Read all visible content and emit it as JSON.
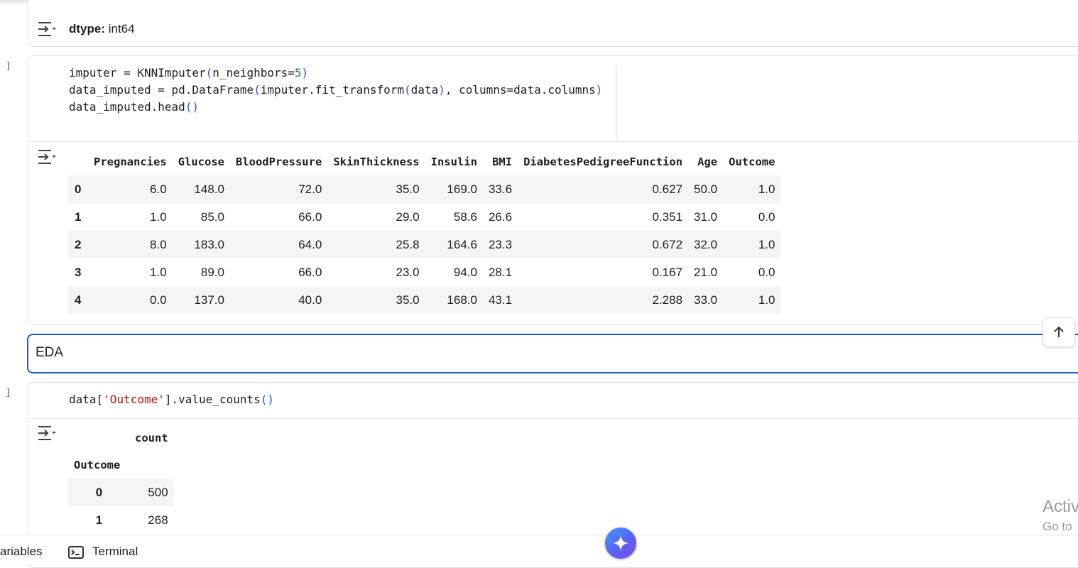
{
  "cells": [
    {
      "type": "output_only",
      "output": {
        "label_bold": "dtype:",
        "label_value": " int64"
      }
    },
    {
      "type": "code",
      "bracket": "]",
      "code_lines": [
        "imputer = KNNImputer(n_neighbors=5)",
        "data_imputed = pd.DataFrame(imputer.fit_transform(data), columns=data.columns)",
        "data_imputed.head()"
      ],
      "table": {
        "columns": [
          "",
          "Pregnancies",
          "Glucose",
          "BloodPressure",
          "SkinThickness",
          "Insulin",
          "BMI",
          "DiabetesPedigreeFunction",
          "Age",
          "Outcome"
        ],
        "rows": [
          [
            "0",
            "6.0",
            "148.0",
            "72.0",
            "35.0",
            "169.0",
            "33.6",
            "0.627",
            "50.0",
            "1.0"
          ],
          [
            "1",
            "1.0",
            "85.0",
            "66.0",
            "29.0",
            "58.6",
            "26.6",
            "0.351",
            "31.0",
            "0.0"
          ],
          [
            "2",
            "8.0",
            "183.0",
            "64.0",
            "25.8",
            "164.6",
            "23.3",
            "0.672",
            "32.0",
            "1.0"
          ],
          [
            "3",
            "1.0",
            "89.0",
            "66.0",
            "23.0",
            "94.0",
            "28.1",
            "0.167",
            "21.0",
            "0.0"
          ],
          [
            "4",
            "0.0",
            "137.0",
            "40.0",
            "35.0",
            "168.0",
            "43.1",
            "2.288",
            "33.0",
            "1.0"
          ]
        ]
      }
    },
    {
      "type": "markdown",
      "text": "EDA"
    },
    {
      "type": "code",
      "bracket": "]",
      "code_line": "data['Outcome'].value_counts()",
      "table": {
        "column_header": "count",
        "index_header": "Outcome",
        "rows": [
          [
            "0",
            "500"
          ],
          [
            "1",
            "268"
          ]
        ]
      }
    }
  ],
  "watermark": {
    "line1": "Activ",
    "line2": "Go to"
  },
  "bottom_bar": {
    "variables": "ariables",
    "terminal": "Terminal"
  },
  "icons": [
    "output-toggle-icon",
    "arrow-up-icon",
    "terminal-icon",
    "gemini-sparkle-icon"
  ],
  "colors": {
    "accent": "#1e5fba",
    "string": "#b31412",
    "number": "#1b8a3a",
    "paren": "#2f55c6"
  }
}
